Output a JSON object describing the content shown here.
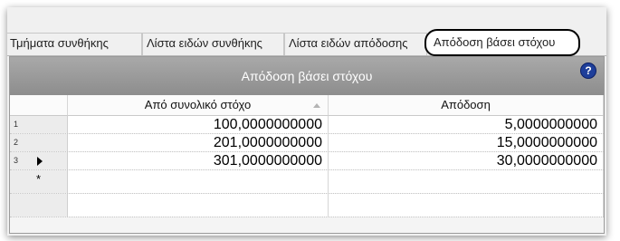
{
  "tabs": [
    {
      "label": "Τμήματα συνθήκης",
      "active": false
    },
    {
      "label": "Λίστα ειδών συνθήκης",
      "active": false
    },
    {
      "label": "Λίστα ειδών απόδοσης",
      "active": false
    },
    {
      "label": "Απόδοση βάσει στόχου",
      "active": true
    }
  ],
  "grid": {
    "caption": "Απόδοση βάσει στόχου",
    "help_icon": "?",
    "columns": [
      "Από συνολικό στόχο",
      "Απόδοση"
    ],
    "rows": [
      {
        "num": "1",
        "from_target": "100,0000000000",
        "yield": "5,0000000000",
        "current": false
      },
      {
        "num": "2",
        "from_target": "201,0000000000",
        "yield": "15,0000000000",
        "current": false
      },
      {
        "num": "3",
        "from_target": "301,0000000000",
        "yield": "30,0000000000",
        "current": true
      }
    ],
    "new_row_marker": "*"
  },
  "colors": {
    "caption_bg": "#999999",
    "help_icon": "#1f3f9a",
    "active_tab_outline": "#000000"
  }
}
